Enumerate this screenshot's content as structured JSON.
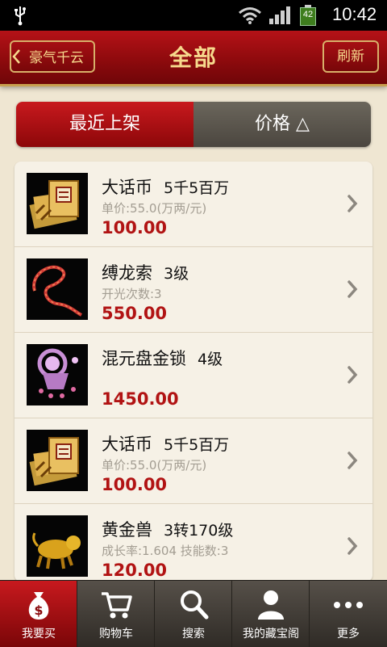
{
  "status_bar": {
    "time": "10:42",
    "battery": "42"
  },
  "header": {
    "back_label": "豪气千云",
    "title": "全部",
    "refresh_label": "刷新"
  },
  "segment": {
    "left_label": "最近上架",
    "right_label": "价格 △"
  },
  "items": [
    {
      "name": "大话币",
      "spec": "5千5百万",
      "sub": "单价:55.0(万两/元)",
      "price": "100.00",
      "icon": "coin-pile-icon"
    },
    {
      "name": "缚龙索",
      "spec": "3级",
      "sub": "开光次数:3",
      "price": "550.00",
      "icon": "rope-icon"
    },
    {
      "name": "混元盘金锁",
      "spec": "4级",
      "sub": "",
      "price": "1450.00",
      "icon": "golden-lock-icon"
    },
    {
      "name": "大话币",
      "spec": "5千5百万",
      "sub": "单价:55.0(万两/元)",
      "price": "100.00",
      "icon": "coin-pile-icon"
    },
    {
      "name": "黄金兽",
      "spec": "3转170级",
      "sub": "成长率:1.604 技能数:3",
      "price": "120.00",
      "icon": "golden-beast-icon"
    }
  ],
  "tabs": [
    {
      "label": "我要买",
      "icon": "money-bag-icon",
      "active": true
    },
    {
      "label": "购物车",
      "icon": "cart-icon",
      "active": false
    },
    {
      "label": "搜索",
      "icon": "search-icon",
      "active": false
    },
    {
      "label": "我的藏宝阁",
      "icon": "user-icon",
      "active": false
    },
    {
      "label": "更多",
      "icon": "more-icon",
      "active": false
    }
  ],
  "colors": {
    "header_red": "#9e0d11",
    "price_red": "#b11313",
    "gold_text": "#f6d98d"
  }
}
